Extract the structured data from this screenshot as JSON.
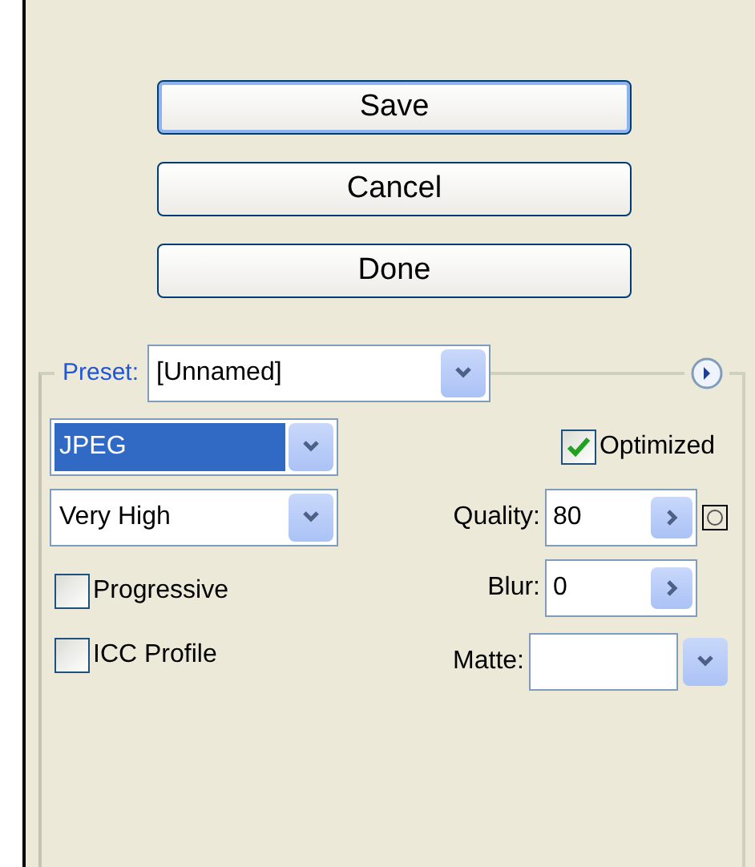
{
  "buttons": [
    {
      "label": "Save",
      "default": true
    },
    {
      "label": "Cancel",
      "default": false
    },
    {
      "label": "Done",
      "default": false
    }
  ],
  "preset": {
    "label": "Preset:",
    "value": "[Unnamed]"
  },
  "format": {
    "value": "JPEG",
    "focused": true
  },
  "quality_preset": {
    "value": "Very High",
    "focused": false
  },
  "options": [
    {
      "label": "Progressive",
      "checked": false
    },
    {
      "label": "ICC Profile",
      "checked": false
    }
  ],
  "optimized": {
    "label": "Optimized",
    "checked": true
  },
  "quality": {
    "label": "Quality:",
    "value": "80"
  },
  "blur": {
    "label": "Blur:",
    "value": "0"
  },
  "matte": {
    "label": "Matte:"
  }
}
